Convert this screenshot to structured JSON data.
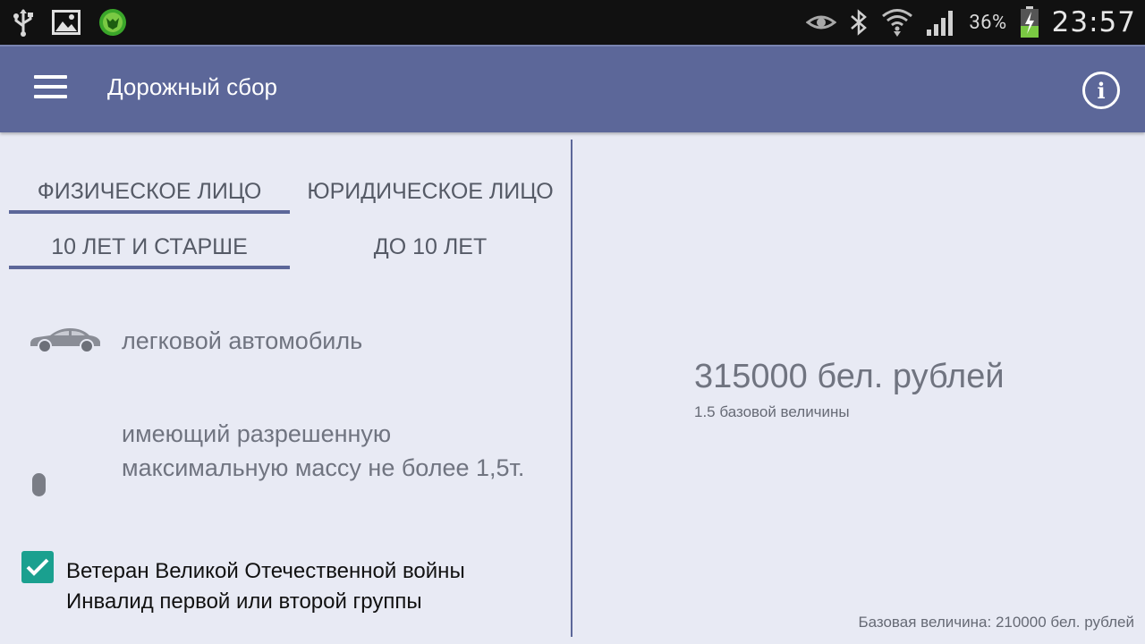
{
  "status_bar": {
    "battery_percent": "36%",
    "time": "23:57",
    "icons": [
      "usb-icon",
      "image-icon",
      "antivirus-icon",
      "eye-icon",
      "bluetooth-icon",
      "wifi-icon",
      "signal-icon",
      "battery-charging-icon"
    ]
  },
  "appbar": {
    "title": "Дорожный сбор",
    "menu_icon": "hamburger-menu-icon",
    "info_icon": "info-icon"
  },
  "person_tabs": [
    {
      "label": "ФИЗИЧЕСКОЕ ЛИЦО",
      "active": true
    },
    {
      "label": "ЮРИДИЧЕСКОЕ ЛИЦО",
      "active": false
    }
  ],
  "age_tabs": [
    {
      "label": "10 ЛЕТ И СТАРШЕ",
      "active": true
    },
    {
      "label": "ДО 10 ЛЕТ",
      "active": false
    }
  ],
  "vehicle": {
    "label": "легковой автомобиль",
    "icon": "car-icon"
  },
  "mass": {
    "label": "имеющий разрешенную максимальную массу не более 1,5т."
  },
  "exemption": {
    "checked": true,
    "line1": "Ветеран Великой Отечественной войны",
    "line2": "Инвалид первой или второй группы"
  },
  "result": {
    "amount": "315000 бел. рублей",
    "base_multiplier": "1.5 базовой величины"
  },
  "footer": {
    "base_value": "Базовая величина: 210000 бел. рублей"
  },
  "colors": {
    "appbar": "#5c6799",
    "background": "#e8eaf4",
    "accent": "#1aa08f",
    "statusbar": "#111111"
  }
}
